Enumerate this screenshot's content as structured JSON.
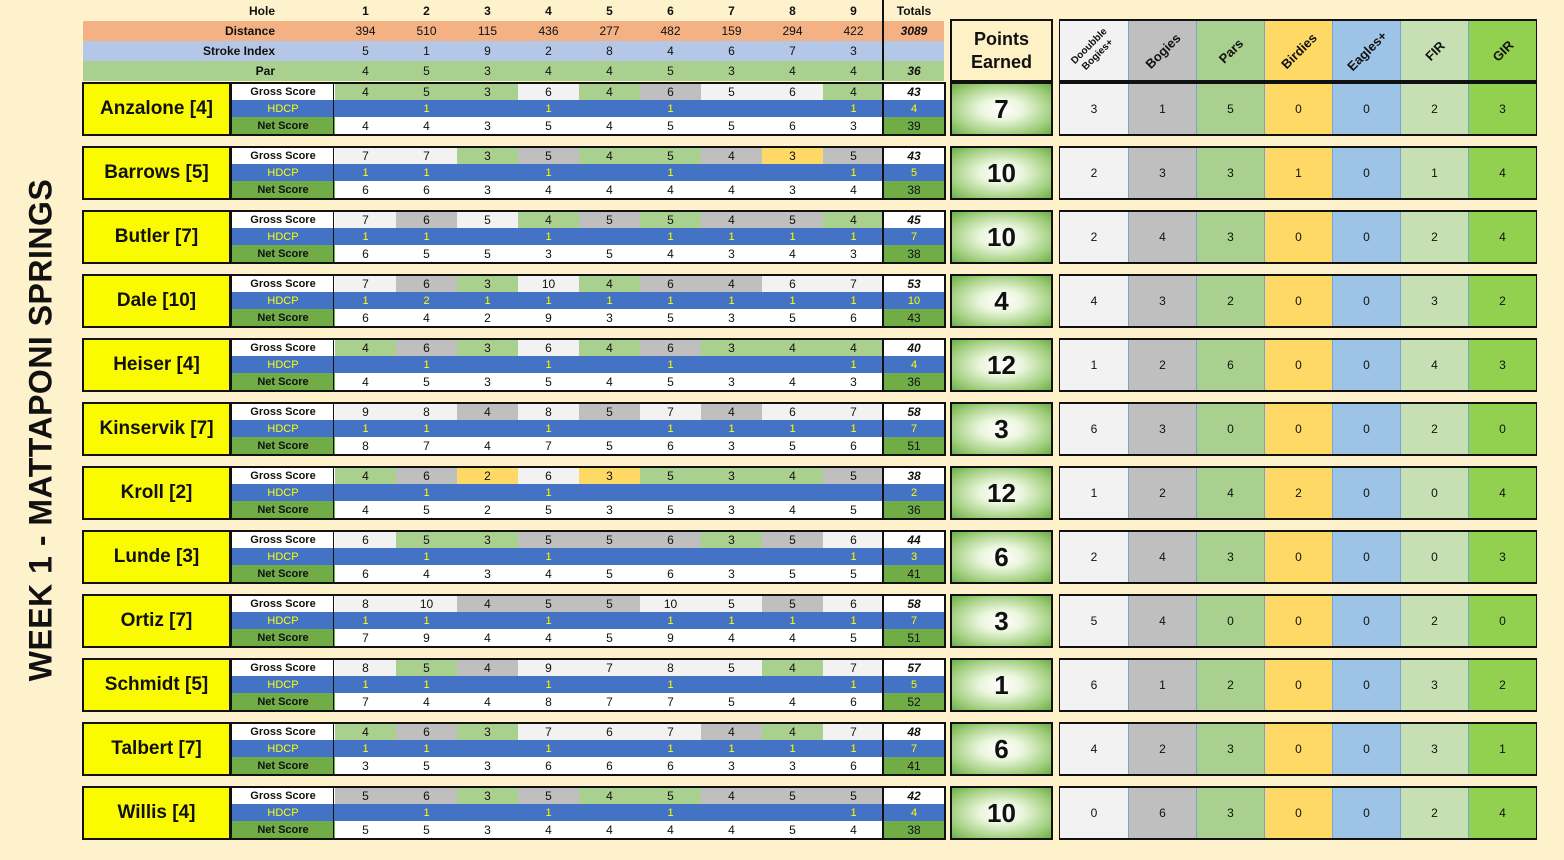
{
  "week_title": "WEEK 1 - MATTAPONI SPRINGS",
  "labels": {
    "hole": "Hole",
    "distance": "Distance",
    "stroke_index": "Stroke Index",
    "par": "Par",
    "totals": "Totals",
    "gross": "Gross Score",
    "hdcp": "HDCP",
    "net": "Net Score",
    "points_line1": "Points",
    "points_line2": "Earned"
  },
  "course": {
    "holes": [
      "1",
      "2",
      "3",
      "4",
      "5",
      "6",
      "7",
      "8",
      "9"
    ],
    "distance": [
      "394",
      "510",
      "115",
      "436",
      "277",
      "482",
      "159",
      "294",
      "422"
    ],
    "distance_total": "3089",
    "stroke_index": [
      "5",
      "1",
      "9",
      "2",
      "8",
      "4",
      "6",
      "7",
      "3"
    ],
    "par": [
      "4",
      "5",
      "3",
      "4",
      "4",
      "5",
      "3",
      "4",
      "4"
    ],
    "par_total": "36"
  },
  "stat_headers": [
    {
      "label": "Dooubble Bogies+",
      "color": "#f2f2f2"
    },
    {
      "label": "Bogies",
      "color": "#bfbfbf"
    },
    {
      "label": "Pars",
      "color": "#a9d08e"
    },
    {
      "label": "Birdies",
      "color": "#ffd966"
    },
    {
      "label": "Eagles+",
      "color": "#9dc3e6"
    },
    {
      "label": "FIR",
      "color": "#c6e0b4"
    },
    {
      "label": "GIR",
      "color": "#92d050"
    }
  ],
  "colors": {
    "background": "#fdf2cc",
    "player_yellow": "#fbfb00",
    "hdcp_blue": "#4472c4",
    "hdcp_text": "#ffff00",
    "net_green": "#70ad47",
    "distance_orange": "#f4b183",
    "stroke_blue": "#b4c7e7",
    "par_green": "#a9d08e",
    "double_bogey": "#f2f2f2",
    "bogey": "#bfbfbf",
    "par": "#a9d08e",
    "birdie": "#ffd966"
  },
  "players": [
    {
      "name": "Anzalone [4]",
      "gross": [
        "4",
        "5",
        "3",
        "6",
        "4",
        "6",
        "5",
        "6",
        "4"
      ],
      "gross_total": "43",
      "hdcp": [
        "",
        "1",
        "",
        "1",
        "",
        "1",
        "",
        "",
        "1"
      ],
      "hdcp_total": "4",
      "net": [
        "4",
        "4",
        "3",
        "5",
        "4",
        "5",
        "5",
        "6",
        "3"
      ],
      "net_total": "39",
      "points": "7",
      "stats": [
        "3",
        "1",
        "5",
        "0",
        "0",
        "2",
        "3"
      ]
    },
    {
      "name": "Barrows [5]",
      "gross": [
        "7",
        "7",
        "3",
        "5",
        "4",
        "5",
        "4",
        "3",
        "5"
      ],
      "gross_total": "43",
      "hdcp": [
        "1",
        "1",
        "",
        "1",
        "",
        "1",
        "",
        "",
        "1"
      ],
      "hdcp_total": "5",
      "net": [
        "6",
        "6",
        "3",
        "4",
        "4",
        "4",
        "4",
        "3",
        "4"
      ],
      "net_total": "38",
      "points": "10",
      "stats": [
        "2",
        "3",
        "3",
        "1",
        "0",
        "1",
        "4"
      ]
    },
    {
      "name": "Butler [7]",
      "gross": [
        "7",
        "6",
        "5",
        "4",
        "5",
        "5",
        "4",
        "5",
        "4"
      ],
      "gross_total": "45",
      "hdcp": [
        "1",
        "1",
        "",
        "1",
        "",
        "1",
        "1",
        "1",
        "1"
      ],
      "hdcp_total": "7",
      "net": [
        "6",
        "5",
        "5",
        "3",
        "5",
        "4",
        "3",
        "4",
        "3"
      ],
      "net_total": "38",
      "points": "10",
      "stats": [
        "2",
        "4",
        "3",
        "0",
        "0",
        "2",
        "4"
      ]
    },
    {
      "name": "Dale [10]",
      "gross": [
        "7",
        "6",
        "3",
        "10",
        "4",
        "6",
        "4",
        "6",
        "7"
      ],
      "gross_total": "53",
      "hdcp": [
        "1",
        "2",
        "1",
        "1",
        "1",
        "1",
        "1",
        "1",
        "1"
      ],
      "hdcp_total": "10",
      "net": [
        "6",
        "4",
        "2",
        "9",
        "3",
        "5",
        "3",
        "5",
        "6"
      ],
      "net_total": "43",
      "points": "4",
      "stats": [
        "4",
        "3",
        "2",
        "0",
        "0",
        "3",
        "2"
      ]
    },
    {
      "name": "Heiser [4]",
      "gross": [
        "4",
        "6",
        "3",
        "6",
        "4",
        "6",
        "3",
        "4",
        "4"
      ],
      "gross_total": "40",
      "hdcp": [
        "",
        "1",
        "",
        "1",
        "",
        "1",
        "",
        "",
        "1"
      ],
      "hdcp_total": "4",
      "net": [
        "4",
        "5",
        "3",
        "5",
        "4",
        "5",
        "3",
        "4",
        "3"
      ],
      "net_total": "36",
      "points": "12",
      "stats": [
        "1",
        "2",
        "6",
        "0",
        "0",
        "4",
        "3"
      ]
    },
    {
      "name": "Kinservik [7]",
      "gross": [
        "9",
        "8",
        "4",
        "8",
        "5",
        "7",
        "4",
        "6",
        "7"
      ],
      "gross_total": "58",
      "hdcp": [
        "1",
        "1",
        "",
        "1",
        "",
        "1",
        "1",
        "1",
        "1"
      ],
      "hdcp_total": "7",
      "net": [
        "8",
        "7",
        "4",
        "7",
        "5",
        "6",
        "3",
        "5",
        "6"
      ],
      "net_total": "51",
      "points": "3",
      "stats": [
        "6",
        "3",
        "0",
        "0",
        "0",
        "2",
        "0"
      ]
    },
    {
      "name": "Kroll [2]",
      "gross": [
        "4",
        "6",
        "2",
        "6",
        "3",
        "5",
        "3",
        "4",
        "5"
      ],
      "gross_total": "38",
      "hdcp": [
        "",
        "1",
        "",
        "1",
        "",
        "",
        "",
        "",
        ""
      ],
      "hdcp_total": "2",
      "net": [
        "4",
        "5",
        "2",
        "5",
        "3",
        "5",
        "3",
        "4",
        "5"
      ],
      "net_total": "36",
      "points": "12",
      "stats": [
        "1",
        "2",
        "4",
        "2",
        "0",
        "0",
        "4"
      ]
    },
    {
      "name": "Lunde [3]",
      "gross": [
        "6",
        "5",
        "3",
        "5",
        "5",
        "6",
        "3",
        "5",
        "6"
      ],
      "gross_total": "44",
      "hdcp": [
        "",
        "1",
        "",
        "1",
        "",
        "",
        "",
        "",
        "1"
      ],
      "hdcp_total": "3",
      "net": [
        "6",
        "4",
        "3",
        "4",
        "5",
        "6",
        "3",
        "5",
        "5"
      ],
      "net_total": "41",
      "points": "6",
      "stats": [
        "2",
        "4",
        "3",
        "0",
        "0",
        "0",
        "3"
      ]
    },
    {
      "name": "Ortiz [7]",
      "gross": [
        "8",
        "10",
        "4",
        "5",
        "5",
        "10",
        "5",
        "5",
        "6"
      ],
      "gross_total": "58",
      "hdcp": [
        "1",
        "1",
        "",
        "1",
        "",
        "1",
        "1",
        "1",
        "1"
      ],
      "hdcp_total": "7",
      "net": [
        "7",
        "9",
        "4",
        "4",
        "5",
        "9",
        "4",
        "4",
        "5"
      ],
      "net_total": "51",
      "points": "3",
      "stats": [
        "5",
        "4",
        "0",
        "0",
        "0",
        "2",
        "0"
      ]
    },
    {
      "name": "Schmidt [5]",
      "gross": [
        "8",
        "5",
        "4",
        "9",
        "7",
        "8",
        "5",
        "4",
        "7"
      ],
      "gross_total": "57",
      "hdcp": [
        "1",
        "1",
        "",
        "1",
        "",
        "1",
        "",
        "",
        "1"
      ],
      "hdcp_total": "5",
      "net": [
        "7",
        "4",
        "4",
        "8",
        "7",
        "7",
        "5",
        "4",
        "6"
      ],
      "net_total": "52",
      "points": "1",
      "stats": [
        "6",
        "1",
        "2",
        "0",
        "0",
        "3",
        "2"
      ]
    },
    {
      "name": "Talbert [7]",
      "gross": [
        "4",
        "6",
        "3",
        "7",
        "6",
        "7",
        "4",
        "4",
        "7"
      ],
      "gross_total": "48",
      "hdcp": [
        "1",
        "1",
        "",
        "1",
        "",
        "1",
        "1",
        "1",
        "1"
      ],
      "hdcp_total": "7",
      "net": [
        "3",
        "5",
        "3",
        "6",
        "6",
        "6",
        "3",
        "3",
        "6"
      ],
      "net_total": "41",
      "points": "6",
      "stats": [
        "4",
        "2",
        "3",
        "0",
        "0",
        "3",
        "1"
      ]
    },
    {
      "name": "Willis [4]",
      "gross": [
        "5",
        "6",
        "3",
        "5",
        "4",
        "5",
        "4",
        "5",
        "5"
      ],
      "gross_total": "42",
      "hdcp": [
        "",
        "1",
        "",
        "1",
        "",
        "1",
        "",
        "",
        "1"
      ],
      "hdcp_total": "4",
      "net": [
        "5",
        "5",
        "3",
        "4",
        "4",
        "4",
        "4",
        "5",
        "4"
      ],
      "net_total": "38",
      "points": "10",
      "stats": [
        "0",
        "6",
        "3",
        "0",
        "0",
        "2",
        "4"
      ]
    }
  ]
}
